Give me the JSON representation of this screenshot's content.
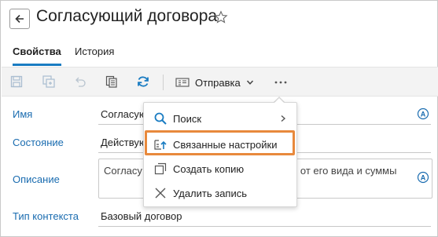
{
  "header": {
    "title": "Согласующий договора",
    "back_icon": "arrow-left-icon",
    "favorite_icon": "star-outline-icon"
  },
  "tabs": [
    {
      "label": "Свойства",
      "active": true
    },
    {
      "label": "История",
      "active": false
    }
  ],
  "toolbar": {
    "icons": [
      "save-icon",
      "save-copy-icon",
      "undo-icon",
      "copy-icon",
      "refresh-icon"
    ],
    "send_label": "Отправка",
    "more_icon": "more-horizontal-icon"
  },
  "form": {
    "name_label": "Имя",
    "name_value": "Согласую",
    "state_label": "Состояние",
    "state_value": "Действую",
    "description_label": "Описание",
    "description_value_start": "Согласу",
    "description_value_end": "и от его вида и суммы",
    "context_label": "Тип контекста",
    "context_value": "Базовый договор"
  },
  "menu": {
    "items": [
      {
        "label": "Поиск",
        "icon": "search-icon",
        "has_submenu": true
      },
      {
        "label": "Связанные настройки",
        "icon": "related-settings-icon",
        "highlighted": true
      },
      {
        "label": "Создать копию",
        "icon": "copy-icon"
      },
      {
        "label": "Удалить запись",
        "icon": "close-icon"
      }
    ]
  },
  "colors": {
    "accent": "#1a7cc2",
    "label_blue": "#1a6cb0",
    "highlight_orange": "#e8893c",
    "toolbar_bg": "#f3f3f3"
  }
}
